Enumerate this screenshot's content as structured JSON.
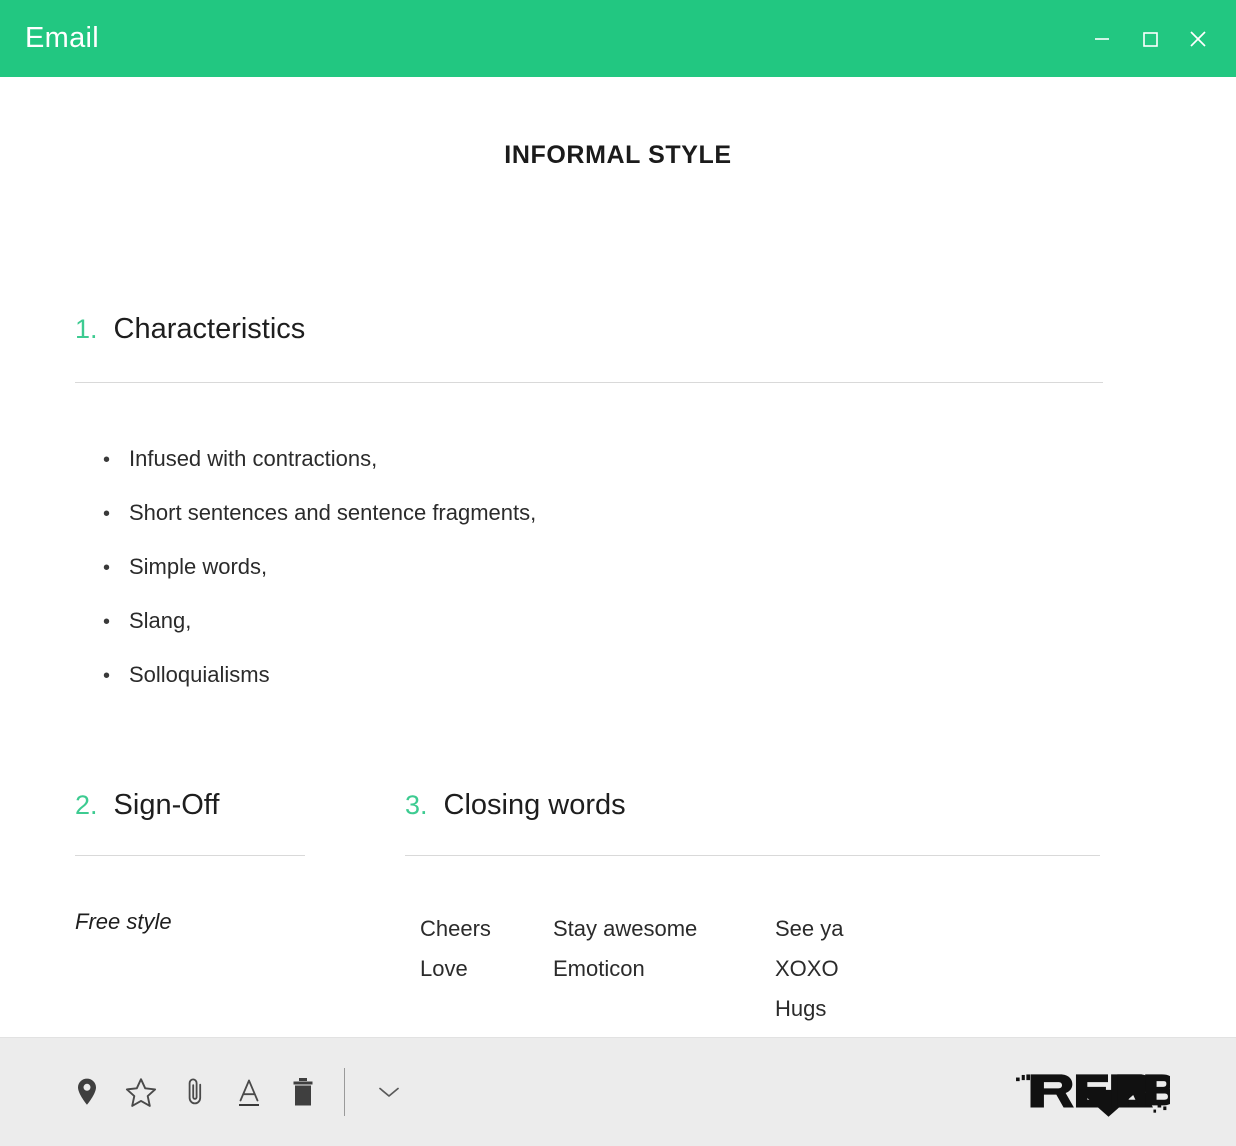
{
  "window": {
    "title": "Email",
    "accent_color": "#22c781",
    "controls": [
      {
        "name": "minimize",
        "glyph": "minimize-icon"
      },
      {
        "name": "maximize",
        "glyph": "maximize-icon"
      },
      {
        "name": "close",
        "glyph": "close-icon"
      }
    ]
  },
  "document": {
    "title": "INFORMAL STYLE",
    "number_color": "#3dcb91",
    "sections": [
      {
        "number": "1.",
        "title": "Characteristics",
        "bullets": [
          "Infused with contractions,",
          "Short sentences and sentence fragments,",
          "Simple words,",
          "Slang,",
          "Solloquialisms"
        ]
      },
      {
        "number": "2.",
        "title": "Sign-Off",
        "body": "Free style"
      },
      {
        "number": "3.",
        "title": "Closing words",
        "columns": [
          [
            "Cheers",
            "Love"
          ],
          [
            "Stay awesome",
            "Emoticon"
          ],
          [
            "See ya",
            "XOXO",
            "Hugs"
          ]
        ]
      }
    ]
  },
  "footer": {
    "tools": [
      {
        "name": "location-pin-icon",
        "label": "Location"
      },
      {
        "name": "star-icon",
        "label": "Favorite"
      },
      {
        "name": "paperclip-icon",
        "label": "Attach"
      },
      {
        "name": "text-format-icon",
        "label": "Text format"
      },
      {
        "name": "trash-icon",
        "label": "Delete"
      }
    ],
    "more": {
      "name": "chevron-down-icon",
      "label": "More options"
    },
    "brand": "REVERB"
  }
}
